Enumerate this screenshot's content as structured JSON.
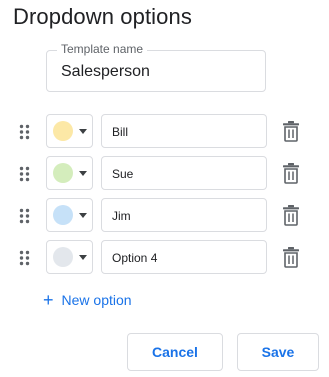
{
  "dialog": {
    "title": "Dropdown options"
  },
  "template": {
    "label": "Template name",
    "value": "Salesperson"
  },
  "options": [
    {
      "label": "Bill",
      "color": "#fce8a6"
    },
    {
      "label": "Sue",
      "color": "#d4edbc"
    },
    {
      "label": "Jim",
      "color": "#c6e1f8"
    },
    {
      "label": "Option 4",
      "color": "#e3e7ec"
    }
  ],
  "actions": {
    "new_option": "New option",
    "cancel": "Cancel",
    "save": "Save"
  },
  "icons": {
    "drag": "drag-handle-icon",
    "dropdown": "caret-down-icon",
    "delete": "trash-icon",
    "add": "plus-icon"
  },
  "colors": {
    "accent": "#1a73e8",
    "border": "#dadce0",
    "icon": "#5f6368"
  }
}
